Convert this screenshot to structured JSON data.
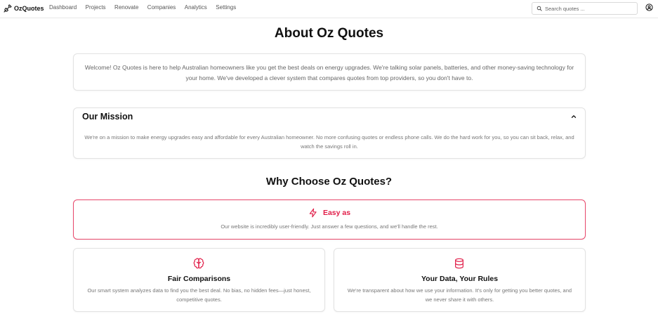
{
  "app": {
    "brand": "OzQuotes"
  },
  "nav": {
    "items": [
      {
        "label": "Dashboard"
      },
      {
        "label": "Projects"
      },
      {
        "label": "Renovate"
      },
      {
        "label": "Companies"
      },
      {
        "label": "Analytics"
      },
      {
        "label": "Settings"
      }
    ]
  },
  "search": {
    "placeholder": "Search quotes ...",
    "value": ""
  },
  "page": {
    "title": "About Oz Quotes"
  },
  "welcome": {
    "text": "Welcome! Oz Quotes is here to help Australian homeowners like you get the best deals on energy upgrades. We're talking solar panels, batteries, and other money-saving technology for your home. We've developed a clever system that compares quotes from top providers, so you don't have to."
  },
  "mission": {
    "title": "Our Mission",
    "text": "We're on a mission to make energy upgrades easy and affordable for every Australian homeowner. No more confusing quotes or endless phone calls. We do the hard work for you, so you can sit back, relax, and watch the savings roll in."
  },
  "why": {
    "title": "Why Choose Oz Quotes?",
    "features": [
      {
        "title": "Easy as",
        "text": "Our website is incredibly user-friendly. Just answer a few questions, and we'll handle the rest.",
        "icon": "lightning-icon"
      },
      {
        "title": "Fair Comparisons",
        "text": "Our smart system analyzes data to find you the best deal. No bias, no hidden fees—just honest, competitive quotes.",
        "icon": "brain-icon"
      },
      {
        "title": "Your Data, Your Rules",
        "text": "We're transparent about how we use your information. It's only for getting you better quotes, and we never share it with others.",
        "icon": "database-icon"
      }
    ]
  },
  "colors": {
    "accent": "#e11d48",
    "highlight_border": "#e8466a"
  }
}
